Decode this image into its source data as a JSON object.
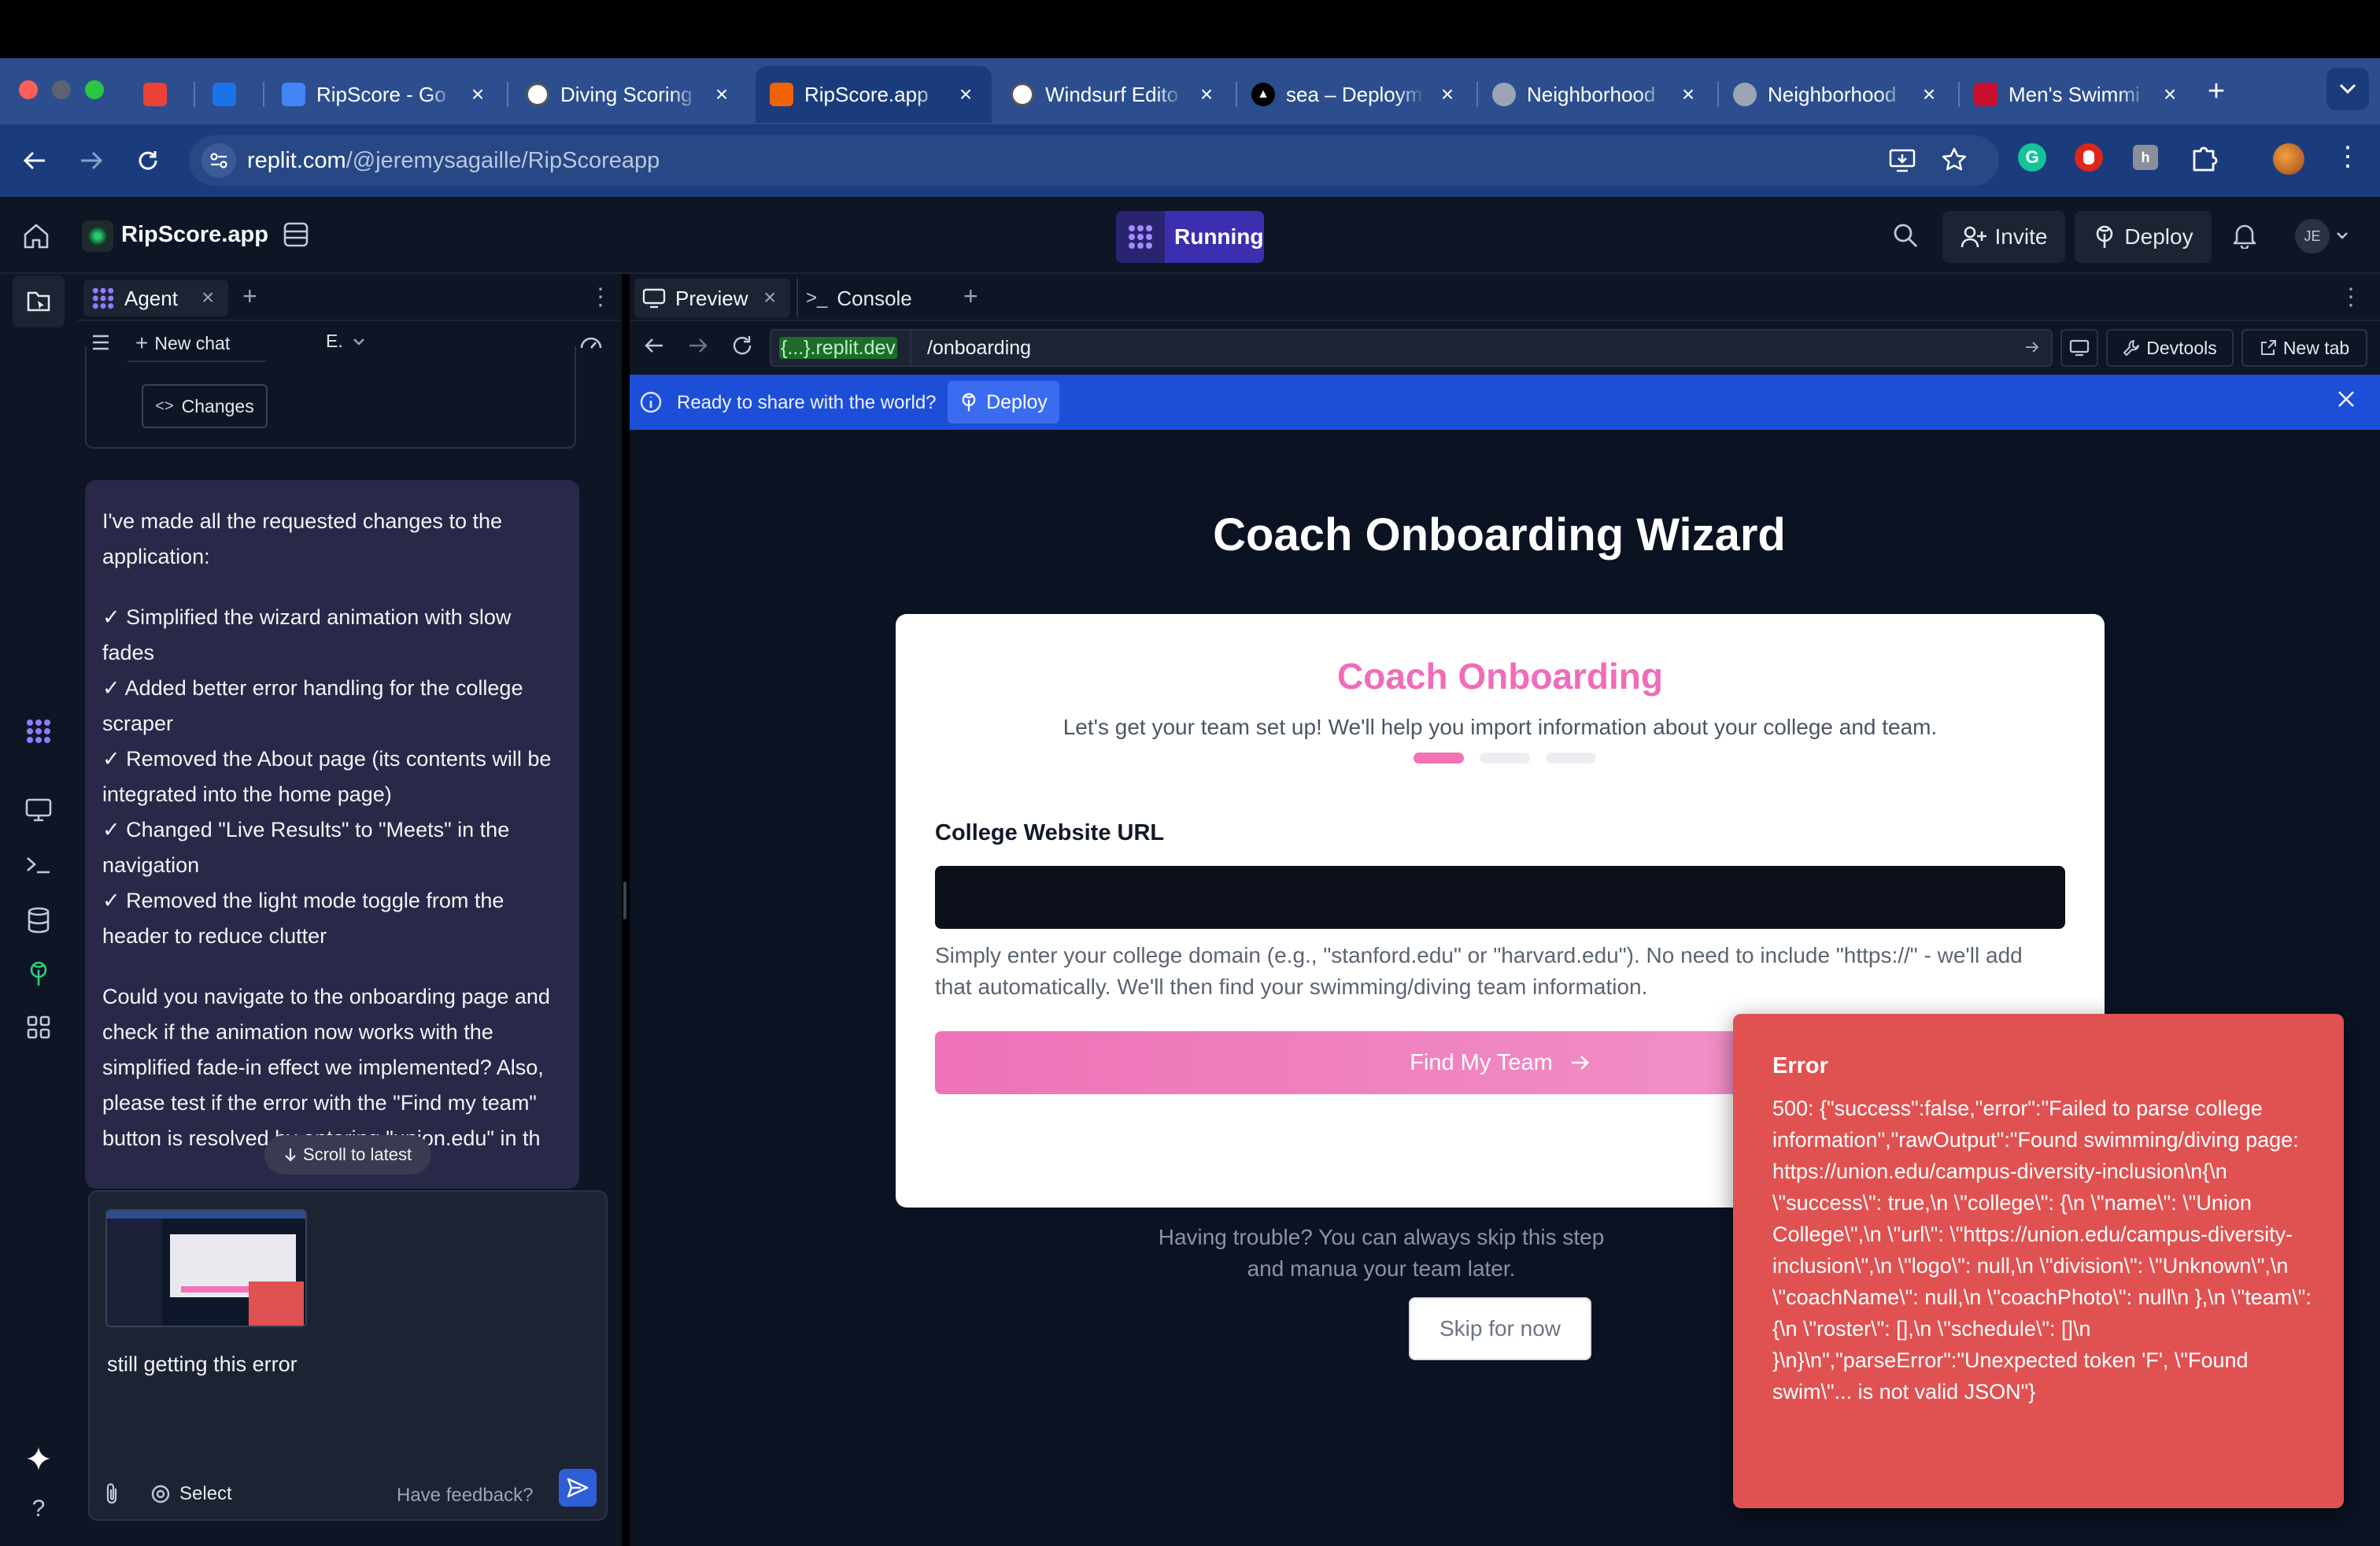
{
  "browser": {
    "tabs": [
      {
        "title": "",
        "favicon": "gmail-icon",
        "color": "#ea4335"
      },
      {
        "title": "",
        "favicon": "outlook-icon",
        "color": "#1a73e8"
      },
      {
        "title": "RipScore - Go",
        "favicon": "google-docs-icon",
        "color": "#4285f4"
      },
      {
        "title": "Diving Scoring",
        "favicon": "chatgpt-icon",
        "color": "#ffffff"
      },
      {
        "title": "RipScore.app",
        "favicon": "replit-icon",
        "color": "#f26207"
      },
      {
        "title": "Windsurf Edito",
        "favicon": "wordpress-icon",
        "color": "#ffffff"
      },
      {
        "title": "sea – Deploym",
        "favicon": "vercel-icon",
        "color": "#000000"
      },
      {
        "title": "Neighborhood",
        "favicon": "globe-icon",
        "color": "#9aa4b5"
      },
      {
        "title": "Neighborhood",
        "favicon": "globe-icon",
        "color": "#9aa4b5"
      },
      {
        "title": "Men's Swimmi",
        "favicon": "shield-icon",
        "color": "#c8102e"
      }
    ],
    "url_host": "replit.com",
    "url_path": "/@jeremysagaille/RipScoreapp"
  },
  "header": {
    "project_name": "RipScore.app",
    "run_status": "Running",
    "invite_label": "Invite",
    "deploy_label": "Deploy",
    "avatar_initials": "JE"
  },
  "agent": {
    "tab_label": "Agent",
    "new_chat_label": "New chat",
    "model_label": "E.",
    "changes_label": "Changes",
    "message_intro": "I've made all the requested changes to the application:",
    "checklist": [
      "✓ Simplified the wizard animation with slow fades",
      "✓ Added better error handling for the college scraper",
      "✓ Removed the About page (its contents will be integrated into the home page)",
      "✓ Changed \"Live Results\" to \"Meets\" in the navigation",
      "✓ Removed the light mode toggle from the header to reduce clutter"
    ],
    "message_outro": "Could you navigate to the onboarding page and check if the animation now works with the simplified fade-in effect we implemented? Also, please test if the error with the \"Find my team\" button is resolved by entering \"union.edu\" in th",
    "scroll_label": "Scroll to latest",
    "input_text": "still getting this error",
    "select_label": "Select",
    "feedback_label": "Have feedback?"
  },
  "panel": {
    "preview_tab": "Preview",
    "console_tab": "Console",
    "domain_label": "{...}.replit.dev",
    "path": "/onboarding",
    "devtools_label": "Devtools",
    "newtab_label": "New tab",
    "banner_text": "Ready to share with the world?",
    "banner_button": "Deploy"
  },
  "page": {
    "title": "Coach Onboarding Wizard",
    "card_title": "Coach Onboarding",
    "card_subtitle": "Let's get your team set up! We'll help you import information about your college and team.",
    "field_label": "College Website URL",
    "field_value": "",
    "help_text": "Simply enter your college domain (e.g., \"stanford.edu\" or \"harvard.edu\"). No need to include \"https://\" - we'll add that automatically. We'll then find your swimming/diving team information.",
    "find_button": "Find My Team",
    "trouble_text": "Having trouble? You can always skip this step and manua your team later.",
    "skip_button": "Skip for now",
    "step_progress": "1/3"
  },
  "toast": {
    "title": "Error",
    "message": "500: {\"success\":false,\"error\":\"Failed to parse college information\",\"rawOutput\":\"Found swimming/diving page: https://union.edu/campus-diversity-inclusion\\n{\\n \\\"success\\\": true,\\n \\\"college\\\": {\\n \\\"name\\\": \\\"Union College\\\",\\n \\\"url\\\": \\\"https://union.edu/campus-diversity-inclusion\\\",\\n \\\"logo\\\": null,\\n \\\"division\\\": \\\"Unknown\\\",\\n \\\"coachName\\\": null,\\n \\\"coachPhoto\\\": null\\n },\\n \\\"team\\\": {\\n \\\"roster\\\": [],\\n \\\"schedule\\\": []\\n }\\n}\\n\",\"parseError\":\"Unexpected token 'F', \\\"Found swim\\\"... is not valid JSON\"}"
  },
  "colors": {
    "accent_pink": "#f472b6",
    "error_red": "#e05252",
    "replit_purple": "#6d4df2",
    "banner_blue": "#1d4ed8"
  }
}
